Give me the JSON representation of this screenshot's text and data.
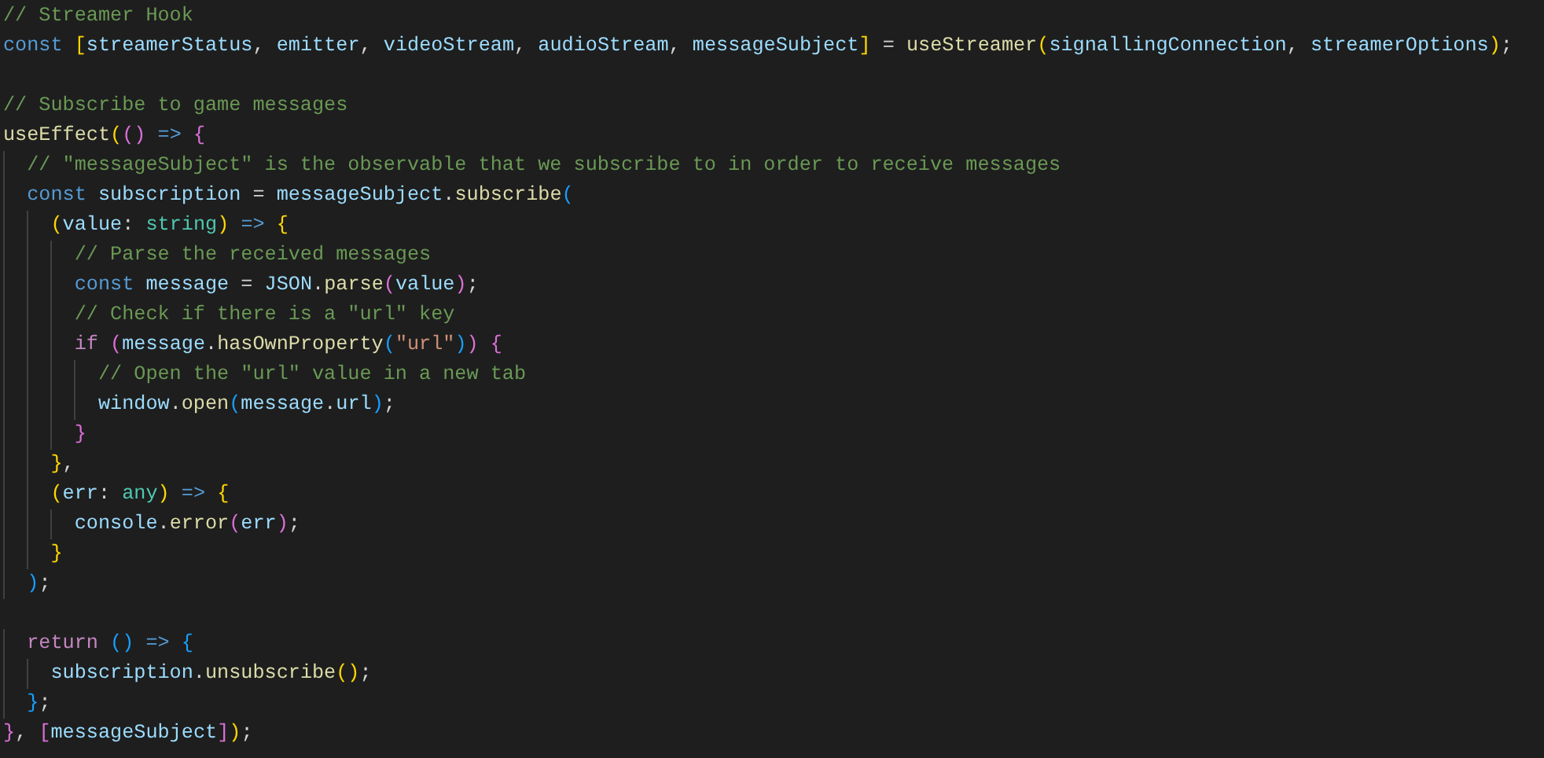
{
  "editor": {
    "lines": [
      {
        "tokens": [
          {
            "kind": "c",
            "text": "// Streamer Hook"
          }
        ]
      },
      {
        "tokens": [
          {
            "kind": "k",
            "text": "const "
          },
          {
            "kind": "b1",
            "text": "["
          },
          {
            "kind": "v",
            "text": "streamerStatus"
          },
          {
            "kind": "p",
            "text": ", "
          },
          {
            "kind": "v",
            "text": "emitter"
          },
          {
            "kind": "p",
            "text": ", "
          },
          {
            "kind": "v",
            "text": "videoStream"
          },
          {
            "kind": "p",
            "text": ", "
          },
          {
            "kind": "v",
            "text": "audioStream"
          },
          {
            "kind": "p",
            "text": ", "
          },
          {
            "kind": "v",
            "text": "messageSubject"
          },
          {
            "kind": "b1",
            "text": "]"
          },
          {
            "kind": "p",
            "text": " = "
          },
          {
            "kind": "f",
            "text": "useStreamer"
          },
          {
            "kind": "b1",
            "text": "("
          },
          {
            "kind": "v",
            "text": "signallingConnection"
          },
          {
            "kind": "p",
            "text": ", "
          },
          {
            "kind": "v",
            "text": "streamerOptions"
          },
          {
            "kind": "b1",
            "text": ")"
          },
          {
            "kind": "p",
            "text": ";"
          }
        ],
        "blank_after": true
      },
      {
        "tokens": [
          {
            "kind": "c",
            "text": "// Subscribe to game messages"
          }
        ]
      },
      {
        "tokens": [
          {
            "kind": "f",
            "text": "useEffect"
          },
          {
            "kind": "b1",
            "text": "("
          },
          {
            "kind": "b2",
            "text": "()"
          },
          {
            "kind": "k",
            "text": " => "
          },
          {
            "kind": "b2",
            "text": "{"
          }
        ]
      },
      {
        "tokens": [
          {
            "kind": "c",
            "text": "  // \"messageSubject\" is the observable that we subscribe to in order to receive messages"
          }
        ]
      },
      {
        "tokens": [
          {
            "kind": "k",
            "text": "  const "
          },
          {
            "kind": "v",
            "text": "subscription"
          },
          {
            "kind": "p",
            "text": " = "
          },
          {
            "kind": "v",
            "text": "messageSubject"
          },
          {
            "kind": "p",
            "text": "."
          },
          {
            "kind": "f",
            "text": "subscribe"
          },
          {
            "kind": "b3",
            "text": "("
          }
        ]
      },
      {
        "tokens": [
          {
            "kind": "b1",
            "text": "    ("
          },
          {
            "kind": "v",
            "text": "value"
          },
          {
            "kind": "p",
            "text": ": "
          },
          {
            "kind": "t",
            "text": "string"
          },
          {
            "kind": "b1",
            "text": ")"
          },
          {
            "kind": "k",
            "text": " => "
          },
          {
            "kind": "b1",
            "text": "{"
          }
        ]
      },
      {
        "tokens": [
          {
            "kind": "c",
            "text": "      // Parse the received messages"
          }
        ]
      },
      {
        "tokens": [
          {
            "kind": "k",
            "text": "      const "
          },
          {
            "kind": "v",
            "text": "message"
          },
          {
            "kind": "p",
            "text": " = "
          },
          {
            "kind": "v",
            "text": "JSON"
          },
          {
            "kind": "p",
            "text": "."
          },
          {
            "kind": "f",
            "text": "parse"
          },
          {
            "kind": "b2",
            "text": "("
          },
          {
            "kind": "v",
            "text": "value"
          },
          {
            "kind": "b2",
            "text": ")"
          },
          {
            "kind": "p",
            "text": ";"
          }
        ]
      },
      {
        "tokens": [
          {
            "kind": "c",
            "text": "      // Check if there is a \"url\" key"
          }
        ]
      },
      {
        "tokens": [
          {
            "kind": "x",
            "text": "      if "
          },
          {
            "kind": "b2",
            "text": "("
          },
          {
            "kind": "v",
            "text": "message"
          },
          {
            "kind": "p",
            "text": "."
          },
          {
            "kind": "f",
            "text": "hasOwnProperty"
          },
          {
            "kind": "b3",
            "text": "("
          },
          {
            "kind": "s",
            "text": "\"url\""
          },
          {
            "kind": "b3",
            "text": ")"
          },
          {
            "kind": "b2",
            "text": ")"
          },
          {
            "kind": "b2",
            "text": " {"
          }
        ]
      },
      {
        "tokens": [
          {
            "kind": "c",
            "text": "        // Open the \"url\" value in a new tab"
          }
        ]
      },
      {
        "tokens": [
          {
            "kind": "v",
            "text": "        window"
          },
          {
            "kind": "p",
            "text": "."
          },
          {
            "kind": "f",
            "text": "open"
          },
          {
            "kind": "b3",
            "text": "("
          },
          {
            "kind": "v",
            "text": "message"
          },
          {
            "kind": "p",
            "text": "."
          },
          {
            "kind": "v",
            "text": "url"
          },
          {
            "kind": "b3",
            "text": ")"
          },
          {
            "kind": "p",
            "text": ";"
          }
        ]
      },
      {
        "tokens": [
          {
            "kind": "b2",
            "text": "      }"
          }
        ]
      },
      {
        "tokens": [
          {
            "kind": "b1",
            "text": "    }"
          },
          {
            "kind": "p",
            "text": ","
          }
        ]
      },
      {
        "tokens": [
          {
            "kind": "b1",
            "text": "    ("
          },
          {
            "kind": "v",
            "text": "err"
          },
          {
            "kind": "p",
            "text": ": "
          },
          {
            "kind": "t",
            "text": "any"
          },
          {
            "kind": "b1",
            "text": ")"
          },
          {
            "kind": "k",
            "text": " => "
          },
          {
            "kind": "b1",
            "text": "{"
          }
        ]
      },
      {
        "tokens": [
          {
            "kind": "v",
            "text": "      console"
          },
          {
            "kind": "p",
            "text": "."
          },
          {
            "kind": "f",
            "text": "error"
          },
          {
            "kind": "b2",
            "text": "("
          },
          {
            "kind": "v",
            "text": "err"
          },
          {
            "kind": "b2",
            "text": ")"
          },
          {
            "kind": "p",
            "text": ";"
          }
        ]
      },
      {
        "tokens": [
          {
            "kind": "b1",
            "text": "    }"
          }
        ]
      },
      {
        "tokens": [
          {
            "kind": "b3",
            "text": "  )"
          },
          {
            "kind": "p",
            "text": ";"
          }
        ],
        "blank_after": true
      },
      {
        "tokens": [
          {
            "kind": "x",
            "text": "  return "
          },
          {
            "kind": "b3",
            "text": "()"
          },
          {
            "kind": "k",
            "text": " => "
          },
          {
            "kind": "b3",
            "text": "{"
          }
        ]
      },
      {
        "tokens": [
          {
            "kind": "v",
            "text": "    subscription"
          },
          {
            "kind": "p",
            "text": "."
          },
          {
            "kind": "f",
            "text": "unsubscribe"
          },
          {
            "kind": "b1",
            "text": "()"
          },
          {
            "kind": "p",
            "text": ";"
          }
        ]
      },
      {
        "tokens": [
          {
            "kind": "b3",
            "text": "  }"
          },
          {
            "kind": "p",
            "text": ";"
          }
        ]
      },
      {
        "tokens": [
          {
            "kind": "b2",
            "text": "}"
          },
          {
            "kind": "p",
            "text": ", "
          },
          {
            "kind": "b2",
            "text": "["
          },
          {
            "kind": "v",
            "text": "messageSubject"
          },
          {
            "kind": "b2",
            "text": "]"
          },
          {
            "kind": "b1",
            "text": ")"
          },
          {
            "kind": "p",
            "text": ";"
          }
        ]
      }
    ]
  }
}
